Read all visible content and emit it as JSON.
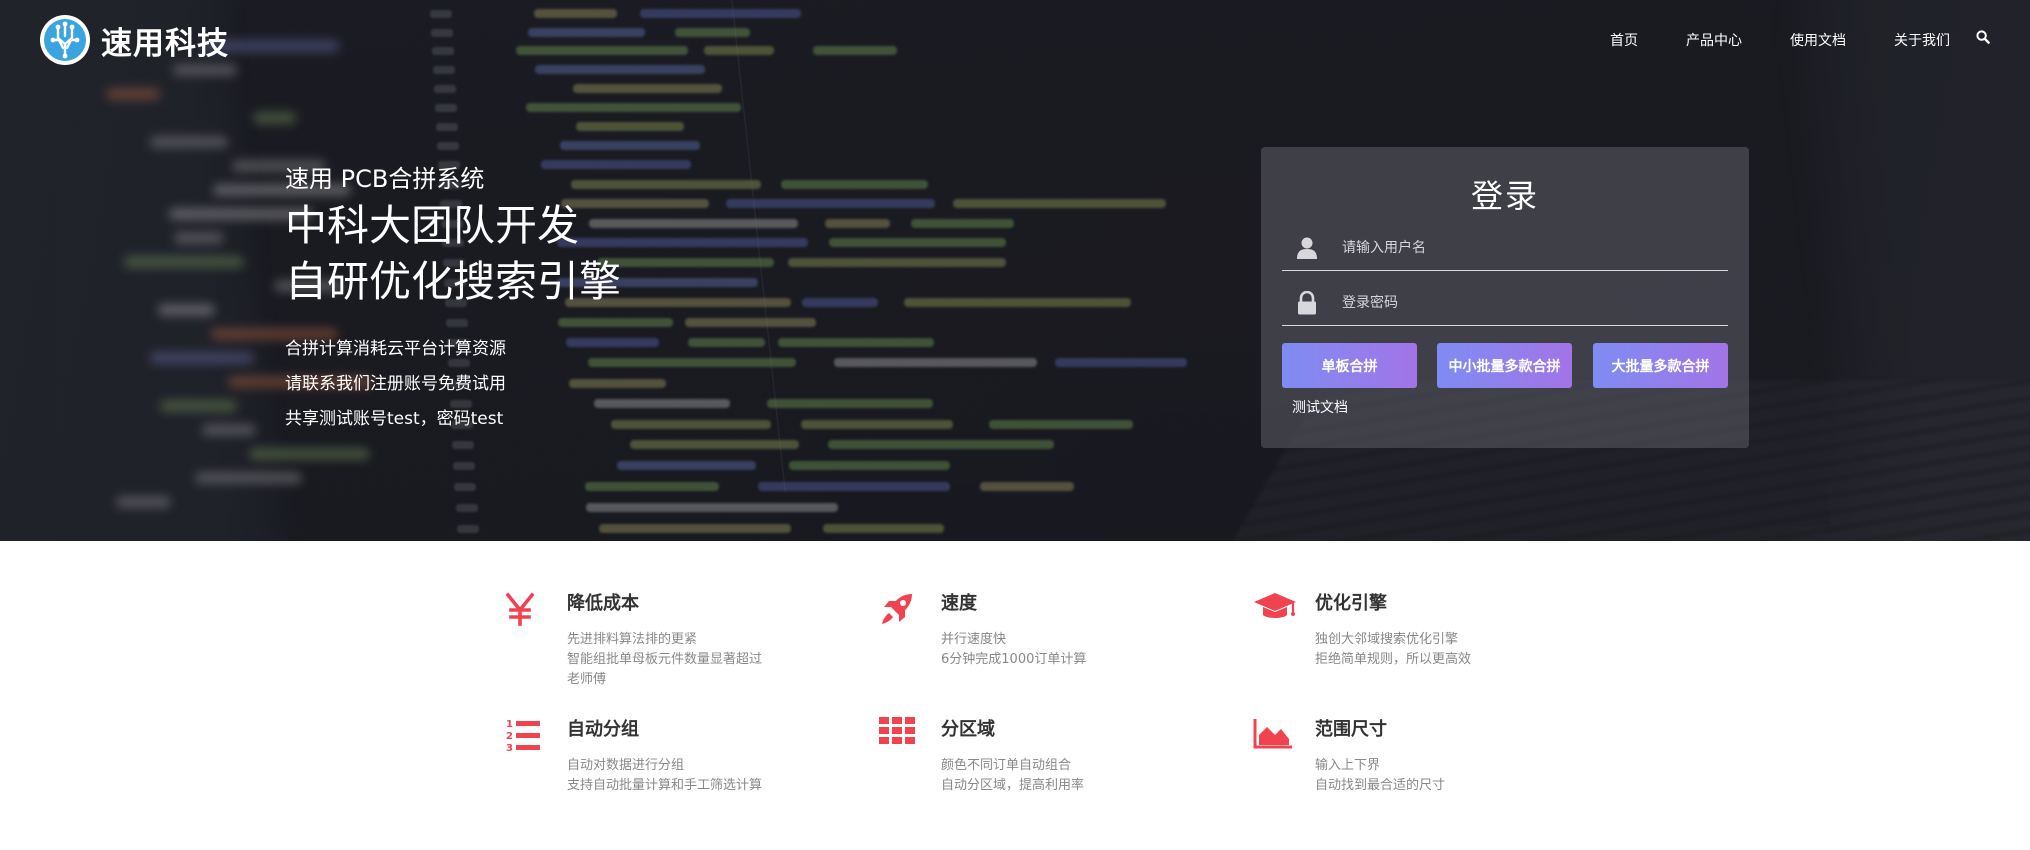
{
  "brand": {
    "name": "速用科技",
    "accent_color": "#f0434f",
    "button_gradient": [
      "#7f8cf3",
      "#a274e6"
    ]
  },
  "nav": {
    "items": [
      {
        "label": "首页"
      },
      {
        "label": "产品中心"
      },
      {
        "label": "使用文档"
      },
      {
        "label": "关于我们"
      }
    ],
    "search_icon": "search-icon"
  },
  "hero": {
    "subtitle": "速用 PCB合拼系统",
    "title_line1": "中科大团队开发",
    "title_line2": "自研优化搜索引擎",
    "desc": [
      "合拼计算消耗云平台计算资源",
      "请联系我们注册账号免费试用",
      "共享测试账号test，密码test"
    ]
  },
  "login": {
    "title": "登录",
    "username_placeholder": "请输入用户名",
    "password_placeholder": "登录密码",
    "buttons": [
      {
        "label": "单板合拼"
      },
      {
        "label": "中小批量多款合拼"
      },
      {
        "label": "大批量多款合拼"
      }
    ],
    "docs_link": "测试文档"
  },
  "features": [
    {
      "icon": "yen-icon",
      "title": "降低成本",
      "desc": [
        "先进排料算法排的更紧",
        "智能组批单母板元件数量显著超过",
        "老师傅"
      ]
    },
    {
      "icon": "rocket-icon",
      "title": "速度",
      "desc": [
        "并行速度快",
        "6分钟完成1000订单计算"
      ]
    },
    {
      "icon": "graduation-cap-icon",
      "title": "优化引擎",
      "desc": [
        "独创大邻域搜索优化引擎",
        "拒绝简单规则，所以更高效"
      ]
    },
    {
      "icon": "ordered-list-icon",
      "title": "自动分组",
      "desc": [
        "自动对数据进行分组",
        "支持自动批量计算和手工筛选计算"
      ]
    },
    {
      "icon": "grid-icon",
      "title": "分区域",
      "desc": [
        "颜色不同订单自动组合",
        "自动分区域，提高利用率"
      ]
    },
    {
      "icon": "area-chart-icon",
      "title": "范围尺寸",
      "desc": [
        "输入上下界",
        "自动找到最合适的尺寸"
      ]
    }
  ]
}
